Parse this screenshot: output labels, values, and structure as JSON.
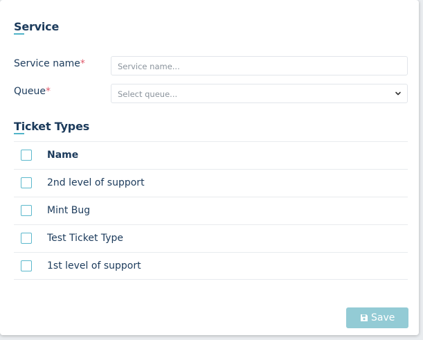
{
  "service_section": {
    "title": "Service",
    "service_name_label": "Service name",
    "service_name_placeholder": "Service name...",
    "queue_label": "Queue",
    "queue_placeholder": "Select queue...",
    "required_marker": "*"
  },
  "ticket_types": {
    "title": "Ticket Types",
    "header": "Name",
    "rows": [
      "2nd level of support",
      "Mint Bug",
      "Test Ticket Type",
      "1st level of support"
    ]
  },
  "actions": {
    "save_label": "Save",
    "save_icon": "floppy-disk-icon"
  },
  "colors": {
    "title_text": "#1b3a5b",
    "accent": "#4fb3c8",
    "required": "#e05a6b",
    "save_button_disabled": "#93cbd5"
  }
}
